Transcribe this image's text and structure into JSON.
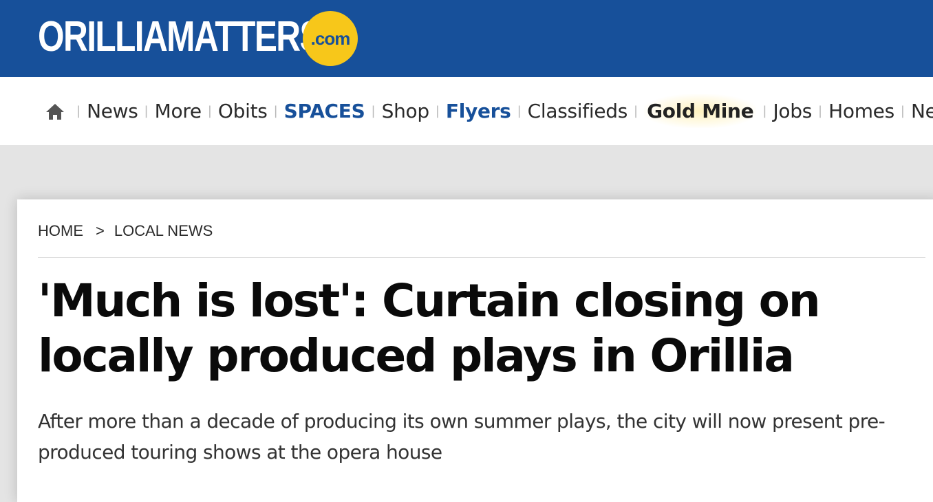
{
  "header": {
    "logo_text": "ORILLIAMATTERS",
    "logo_badge": ".com",
    "brand_color": "#17509a",
    "badge_color": "#f7c71a"
  },
  "nav": {
    "home_icon": "home-icon",
    "items": [
      {
        "label": "News"
      },
      {
        "label": "More"
      },
      {
        "label": "Obits"
      },
      {
        "label": "SPACES"
      },
      {
        "label": "Shop"
      },
      {
        "label": "Flyers"
      },
      {
        "label": "Classifieds"
      },
      {
        "label": "Gold Mine"
      },
      {
        "label": "Jobs"
      },
      {
        "label": "Homes"
      },
      {
        "label": "Ne"
      }
    ]
  },
  "article": {
    "breadcrumb": {
      "home": "HOME",
      "separator": ">",
      "section": "LOCAL NEWS"
    },
    "headline": "'Much is lost': Curtain closing on locally produced plays in Orillia",
    "dek": "After more than a decade of producing its own summer plays, the city will now present pre-produced touring shows at the opera house"
  }
}
